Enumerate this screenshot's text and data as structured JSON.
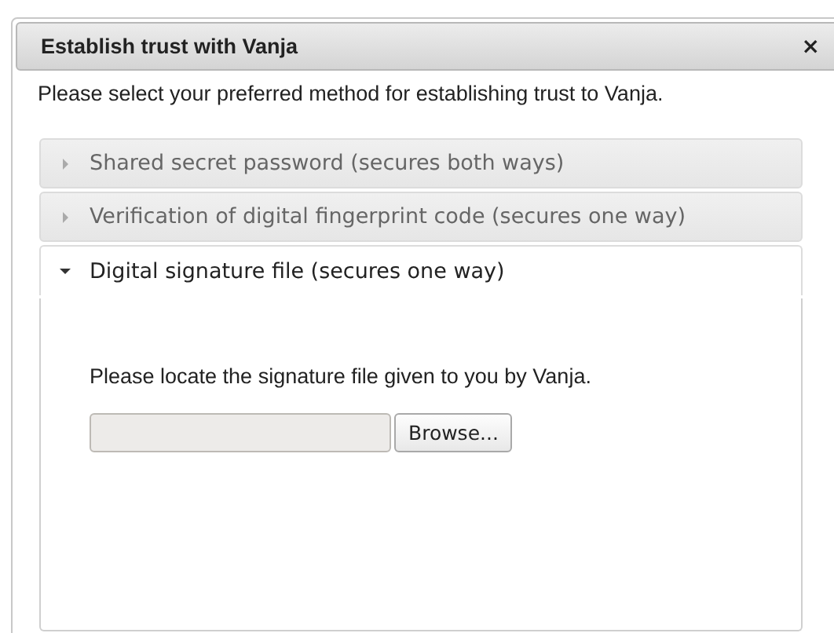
{
  "dialog": {
    "title": "Establish trust with Vanja",
    "close": "×",
    "intro": "Please select your preferred method for establishing trust to Vanja."
  },
  "methods": [
    {
      "label": "Shared secret password (secures both ways)",
      "expanded": false
    },
    {
      "label": "Verification of digital fingerprint code (secures one way)",
      "expanded": false
    },
    {
      "label": "Digital signature file (secures one way)",
      "expanded": true,
      "instruction": "Please locate the signature file given to you by Vanja.",
      "button": "Browse..."
    }
  ]
}
